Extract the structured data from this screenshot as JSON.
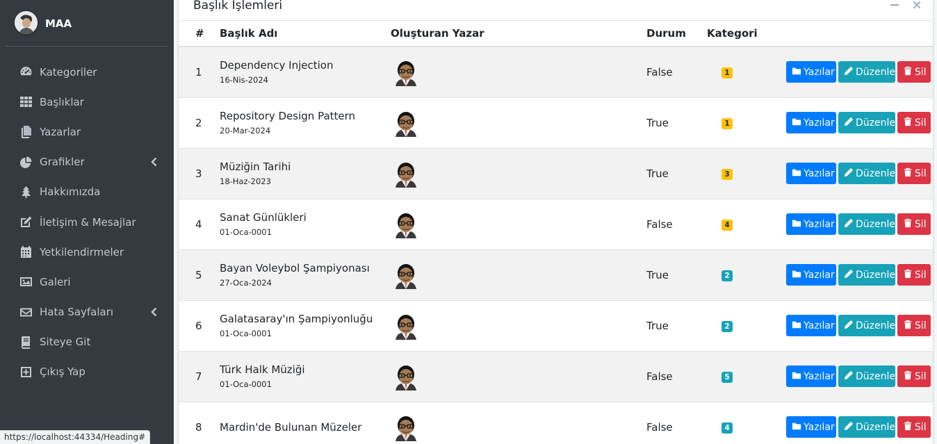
{
  "user": {
    "name": "MAA"
  },
  "sidebar": {
    "items": [
      {
        "label": "Kategoriler",
        "icon": "dashboard-gauge-icon",
        "caret": false
      },
      {
        "label": "Başlıklar",
        "icon": "grid-icon",
        "caret": false
      },
      {
        "label": "Yazarlar",
        "icon": "copy-documents-icon",
        "caret": false
      },
      {
        "label": "Grafikler",
        "icon": "pie-chart-icon",
        "caret": true
      },
      {
        "label": "Hakkımızda",
        "icon": "tree-icon",
        "caret": false
      },
      {
        "label": "İletişim & Mesajlar",
        "icon": "edit-square-icon",
        "caret": false
      },
      {
        "label": "Yetkilendirmeler",
        "icon": "calendar-icon",
        "caret": false
      },
      {
        "label": "Galeri",
        "icon": "image-icon",
        "caret": false
      },
      {
        "label": "Hata Sayfaları",
        "icon": "envelope-icon",
        "caret": true
      },
      {
        "label": "Siteye Git",
        "icon": "book-icon",
        "caret": false
      },
      {
        "label": "Çıkış Yap",
        "icon": "plus-square-icon",
        "caret": false
      }
    ]
  },
  "status_url": "https://localhost:44334/Heading#",
  "card": {
    "title": "Başlık İşlemleri",
    "tools": [
      "minus-icon",
      "close-icon"
    ]
  },
  "table": {
    "columns": [
      "#",
      "Başlık Adı",
      "Oluşturan Yazar",
      "Durum",
      "Kategori"
    ],
    "buttons": {
      "posts": "Yazılar",
      "edit": "Düzenle",
      "delete": "Sil"
    },
    "colors": {
      "primary": "#007bff",
      "info": "#17a2b8",
      "danger": "#dc3545",
      "warning": "#ffc107"
    },
    "rows": [
      {
        "num": "1",
        "title": "Dependency Injection",
        "date": "16-Nis-2024",
        "status": "False",
        "category": "1",
        "badge": "warn"
      },
      {
        "num": "2",
        "title": "Repository Design Pattern",
        "date": "20-Mar-2024",
        "status": "True",
        "category": "1",
        "badge": "warn"
      },
      {
        "num": "3",
        "title": "Müziğin Tarihi",
        "date": "18-Haz-2023",
        "status": "True",
        "category": "3",
        "badge": "warn"
      },
      {
        "num": "4",
        "title": "Sanat Günlükleri",
        "date": "01-Oca-0001",
        "status": "False",
        "category": "4",
        "badge": "warn"
      },
      {
        "num": "5",
        "title": "Bayan Voleybol Şampiyonası",
        "date": "27-Oca-2024",
        "status": "True",
        "category": "2",
        "badge": "info"
      },
      {
        "num": "6",
        "title": "Galatasaray'ın Şampiyonluğu",
        "date": "01-Oca-0001",
        "status": "True",
        "category": "2",
        "badge": "info"
      },
      {
        "num": "7",
        "title": "Türk Halk Müziği",
        "date": "01-Oca-0001",
        "status": "False",
        "category": "5",
        "badge": "info"
      },
      {
        "num": "8",
        "title": "Mardin'de Bulunan Müzeler",
        "date": "",
        "status": "False",
        "category": "4",
        "badge": "info"
      }
    ]
  }
}
